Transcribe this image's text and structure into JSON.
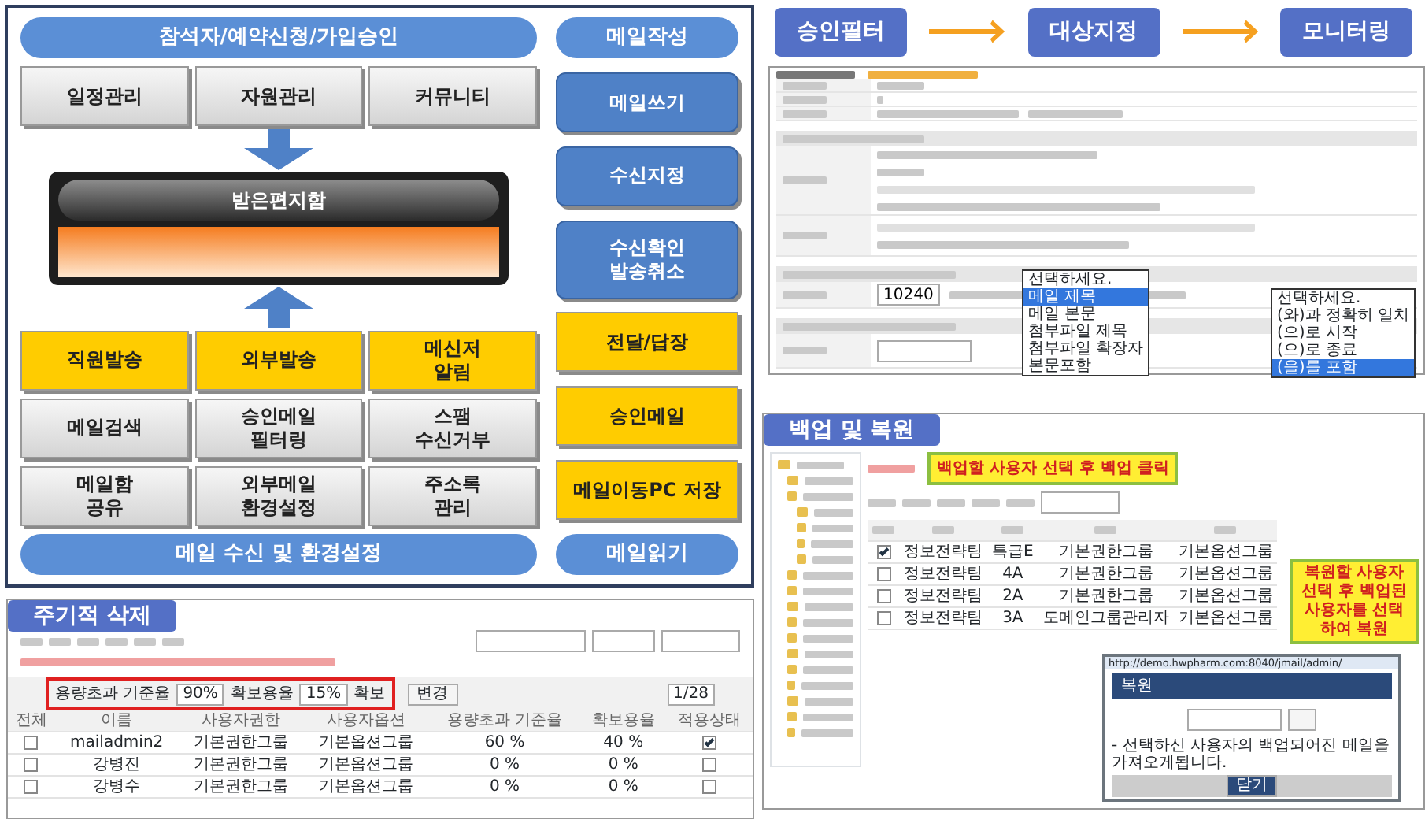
{
  "overview": {
    "top_banner": "참석자/예약신청/가입승인",
    "right_top_banner": "메일작성",
    "top_tiles": [
      {
        "label": "일정관리",
        "kind": "plain"
      },
      {
        "label": "자원관리",
        "kind": "plain"
      },
      {
        "label": "커뮤니티",
        "kind": "plain"
      }
    ],
    "inbox_label": "받은편지함",
    "feature_tiles": [
      {
        "label": "직원발송",
        "kind": "accent"
      },
      {
        "label": "외부발송",
        "kind": "accent"
      },
      {
        "label": "메신저\n알림",
        "kind": "accent"
      },
      {
        "label": "메일검색",
        "kind": "plain"
      },
      {
        "label": "승인메일\n필터링",
        "kind": "plain"
      },
      {
        "label": "스팸\n수신거부",
        "kind": "plain"
      },
      {
        "label": "메일함\n공유",
        "kind": "plain"
      },
      {
        "label": "외부메일\n환경설정",
        "kind": "plain"
      },
      {
        "label": "주소록\n관리",
        "kind": "plain"
      }
    ],
    "side_tiles": [
      {
        "label": "메일쓰기",
        "kind": "primary"
      },
      {
        "label": "수신지정",
        "kind": "primary"
      },
      {
        "label": "수신확인\n발송취소",
        "kind": "primary"
      },
      {
        "label": "전달/답장",
        "kind": "accent"
      },
      {
        "label": "승인메일",
        "kind": "accent"
      },
      {
        "label": "메일이동PC 저장",
        "kind": "accent"
      }
    ],
    "bottom_banner": "메일 수신 및 환경설정",
    "right_bottom_banner": "메일읽기"
  },
  "deletion": {
    "title": "주기적 삭제",
    "threshold_label": "용량초과 기준율",
    "threshold": "90%",
    "secure_label": "확보용율",
    "secure": "15%",
    "secure_suffix": "확보",
    "change_button": "변경",
    "page": "1/28",
    "columns": [
      "전체",
      "이름",
      "사용자권한",
      "사용자옵션",
      "용량초과 기준율",
      "확보용율",
      "적용상태"
    ],
    "rows": [
      {
        "checked": false,
        "name": "mailadmin2",
        "role": "기본권한그룹",
        "option": "기본옵션그룹",
        "limit": "60 %",
        "secured": "40 %",
        "applied": true
      },
      {
        "checked": false,
        "name": "강병진",
        "role": "기본권한그룹",
        "option": "기본옵션그룹",
        "limit": "0 %",
        "secured": "0 %",
        "applied": false
      },
      {
        "checked": false,
        "name": "강병수",
        "role": "기본권한그룹",
        "option": "기본옵션그룹",
        "limit": "0 %",
        "secured": "0 %",
        "applied": false
      }
    ]
  },
  "flow": [
    "승인필터",
    "대상지정",
    "모니터링"
  ],
  "filter_form": {
    "size_value": "10240",
    "field_options": [
      {
        "label": "선택하세요.",
        "selected": false
      },
      {
        "label": "메일 제목",
        "selected": true
      },
      {
        "label": "메일 본문",
        "selected": false
      },
      {
        "label": "첨부파일 제목",
        "selected": false
      },
      {
        "label": "첨부파일 확장자",
        "selected": false
      },
      {
        "label": "본문포함",
        "selected": false
      }
    ],
    "match_options": [
      {
        "label": "선택하세요.",
        "selected": false
      },
      {
        "label": "(와)과 정확히 일치",
        "selected": false
      },
      {
        "label": "(으)로 시작",
        "selected": false
      },
      {
        "label": "(으)로 종료",
        "selected": false
      },
      {
        "label": "(을)를 포함",
        "selected": true
      }
    ]
  },
  "backup": {
    "title": "백업 및 복원",
    "note": "백업할 사용자 선택 후 백업 클릭",
    "restore_note": "복원할 사용자 선택 후 백업된 사용자를 선택하여 복원",
    "rows": [
      {
        "checked": true,
        "dept": "정보전략팀",
        "rank": "특급E",
        "role": "기본권한그룹",
        "option": "기본옵션그룹"
      },
      {
        "checked": false,
        "dept": "정보전략팀",
        "rank": "4A",
        "role": "기본권한그룹",
        "option": "기본옵션그룹"
      },
      {
        "checked": false,
        "dept": "정보전략팀",
        "rank": "2A",
        "role": "기본권한그룹",
        "option": "기본옵션그룹"
      },
      {
        "checked": false,
        "dept": "정보전략팀",
        "rank": "3A",
        "role": "도메인그룹관리자",
        "option": "기본옵션그룹"
      }
    ],
    "popup": {
      "url": "http://demo.hwpharm.com:8040/jmail/admin/",
      "title": "복원",
      "hint": "- 선택하신 사용자의 백업되어진 메일을 가져오게됩니다.",
      "close_button": "닫기"
    }
  }
}
